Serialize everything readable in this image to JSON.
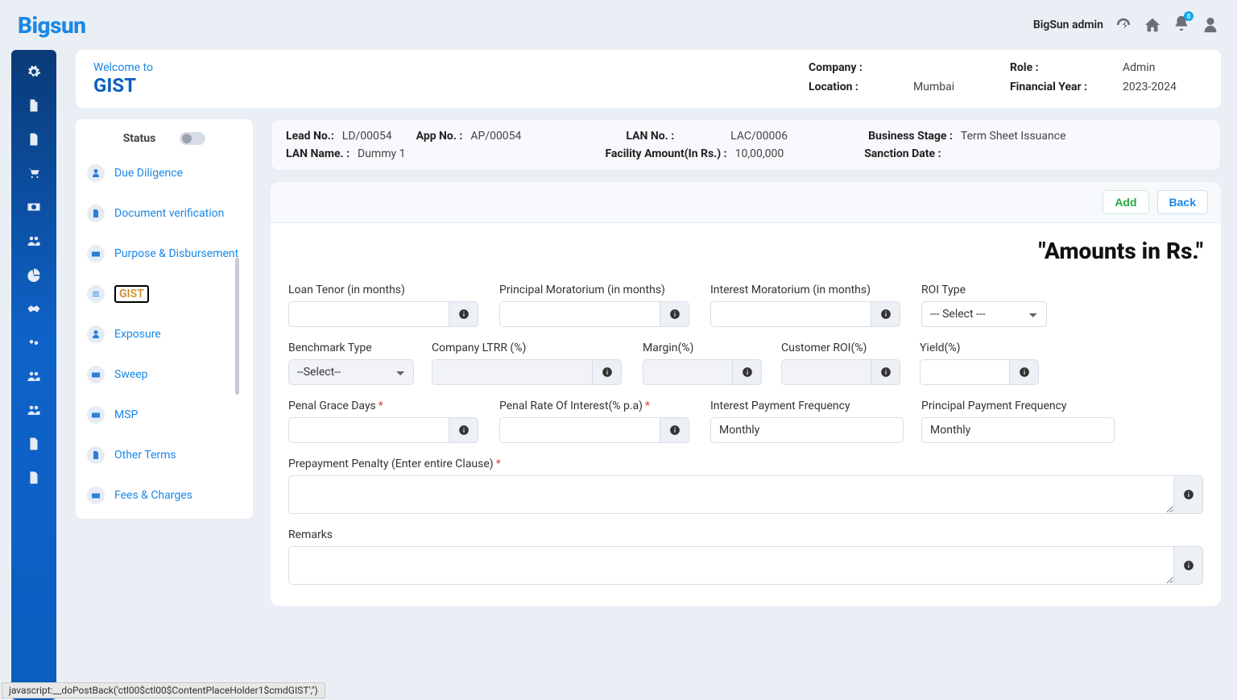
{
  "brand": "Bigsun",
  "top": {
    "user": "BigSun admin",
    "badge": "0"
  },
  "welcome": {
    "prefix": "Welcome to",
    "page": "GIST"
  },
  "info": {
    "company_l": "Company :",
    "company_v": "",
    "role_l": "Role :",
    "role_v": "Admin",
    "location_l": "Location :",
    "location_v": "Mumbai",
    "fy_l": "Financial Year :",
    "fy_v": "2023-2024"
  },
  "status": {
    "title": "Status",
    "items": [
      {
        "label": "Due Diligence"
      },
      {
        "label": "Document verification"
      },
      {
        "label": "Purpose & Disbursement"
      },
      {
        "label": "GIST",
        "active": true
      },
      {
        "label": "Exposure"
      },
      {
        "label": "Sweep"
      },
      {
        "label": "MSP"
      },
      {
        "label": "Other Terms"
      },
      {
        "label": "Fees & Charges"
      }
    ]
  },
  "meta": {
    "lead_l": "Lead No.:",
    "lead_v": "LD/00054",
    "app_l": "App No. :",
    "app_v": "AP/00054",
    "lan_l": "LAN No. :",
    "lan_v": "LAC/00006",
    "stage_l": "Business Stage :",
    "stage_v": "Term Sheet Issuance",
    "lanname_l": "LAN Name. :",
    "lanname_v": "Dummy 1",
    "fac_l": "Facility Amount(In Rs.) :",
    "fac_v": "10,00,000",
    "sanc_l": "Sanction Date :",
    "sanc_v": ""
  },
  "buttons": {
    "add": "Add",
    "back": "Back"
  },
  "form": {
    "title": "\"Amounts in Rs.\"",
    "loan_tenor_l": "Loan Tenor (in months)",
    "prin_mor_l": "Principal Moratorium (in months)",
    "int_mor_l": "Interest Moratorium (in months)",
    "roi_type_l": "ROI Type",
    "roi_type_v": "--- Select ---",
    "bench_l": "Benchmark Type",
    "bench_v": "--Select--",
    "ltrr_l": "Company LTRR (%)",
    "margin_l": "Margin(%)",
    "cust_roi_l": "Customer ROI(%)",
    "yield_l": "Yield(%)",
    "penal_days_l": "Penal Grace Days",
    "penal_rate_l": "Penal Rate Of Interest(% p.a)",
    "int_freq_l": "Interest Payment Frequency",
    "int_freq_v": "Monthly",
    "prin_freq_l": "Principal Payment Frequency",
    "prin_freq_v": "Monthly",
    "prepay_l": "Prepayment Penalty (Enter entire Clause)",
    "remarks_l": "Remarks"
  },
  "statusbar": "javascript:__doPostBack('ctl00$ctl00$ContentPlaceHolder1$cmdGIST','')"
}
